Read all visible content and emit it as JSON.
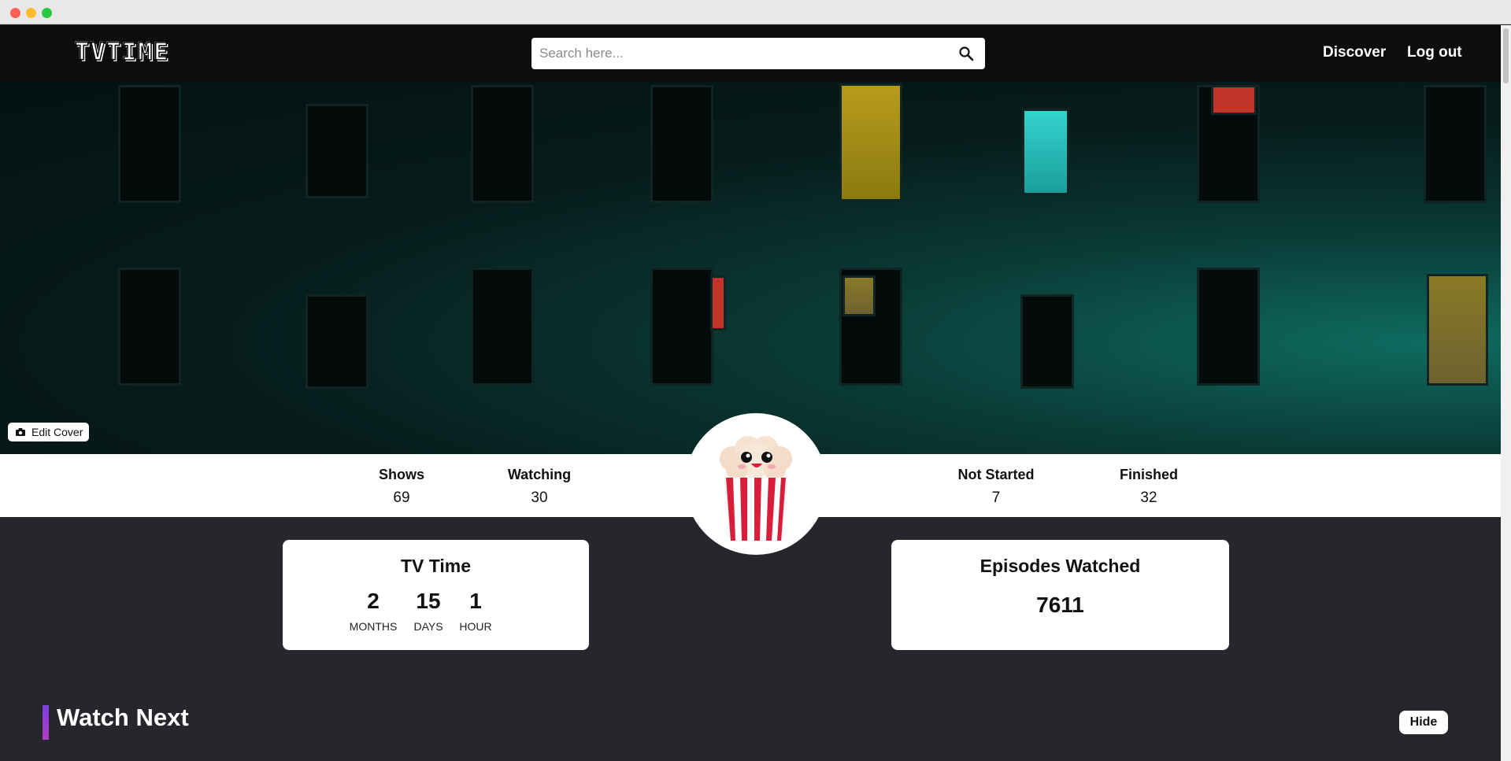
{
  "header": {
    "logo_text": "TVTIME",
    "search_placeholder": "Search here...",
    "nav": {
      "discover": "Discover",
      "logout": "Log out"
    }
  },
  "cover": {
    "edit_label": "Edit Cover"
  },
  "stats": {
    "shows": {
      "label": "Shows",
      "value": "69"
    },
    "watching": {
      "label": "Watching",
      "value": "30"
    },
    "not_started": {
      "label": "Not Started",
      "value": "7"
    },
    "finished": {
      "label": "Finished",
      "value": "32"
    }
  },
  "tv_time": {
    "title": "TV Time",
    "months": {
      "value": "2",
      "unit": "MONTHS"
    },
    "days": {
      "value": "15",
      "unit": "DAYS"
    },
    "hours": {
      "value": "1",
      "unit": "HOUR"
    }
  },
  "episodes": {
    "title": "Episodes Watched",
    "value": "7611"
  },
  "watch_next": {
    "title": "Watch Next",
    "hide_label": "Hide"
  },
  "colors": {
    "accent_gradient_start": "#7a3ee0",
    "accent_gradient_end": "#b33cc4",
    "popcorn_red": "#d81e3a"
  },
  "icons": [
    "search-icon",
    "camera-icon",
    "popcorn-avatar"
  ]
}
